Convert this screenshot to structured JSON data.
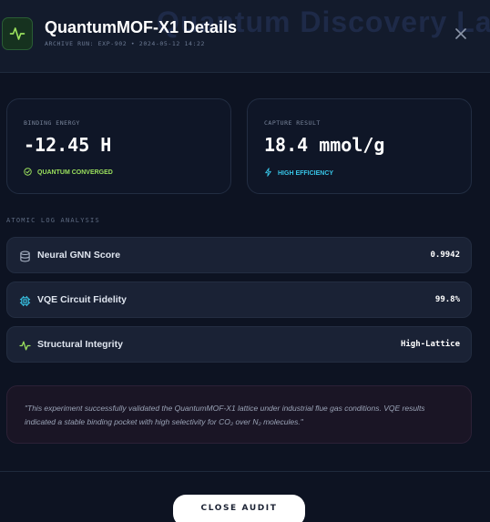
{
  "header": {
    "background_title": "Quantum Discovery Lab",
    "title": "QuantumMOF-X1 Details",
    "subtitle": "ARCHIVE RUN: EXP-902 • 2024-05-12 14:22",
    "logo_icon": "activity-pulse-icon",
    "close_icon": "close-icon"
  },
  "stats": [
    {
      "label": "BINDING ENERGY",
      "value": "-12.45 H",
      "badge": "QUANTUM CONVERGED",
      "badge_icon": "check-circle-icon",
      "badge_color": "#9be15d"
    },
    {
      "label": "CAPTURE RESULT",
      "value": "18.4 mmol/g",
      "badge": "HIGH EFFICIENCY",
      "badge_icon": "lightning-icon",
      "badge_color": "#38c6e8"
    }
  ],
  "log_section": {
    "title": "ATOMIC LOG ANALYSIS",
    "rows": [
      {
        "label": "Neural GNN Score",
        "value": "0.9942",
        "icon": "database-icon",
        "icon_color": "#aab4c6"
      },
      {
        "label": "VQE Circuit Fidelity",
        "value": "99.8%",
        "icon": "cpu-chip-icon",
        "icon_color": "#38c6e8"
      },
      {
        "label": "Structural Integrity",
        "value": "High-Lattice",
        "icon": "activity-pulse-icon",
        "icon_color": "#9be15d"
      }
    ]
  },
  "summary_quote": "\"This experiment successfully validated the QuantumMOF-X1 lattice under industrial flue gas conditions. VQE results indicated a stable binding pocket with high selectivity for CO₂ over N₂ molecules.\"",
  "footer": {
    "close_label": "CLOSE AUDIT"
  },
  "colors": {
    "background": "#0d1322",
    "accent_green": "#9be15d",
    "accent_cyan": "#38c6e8"
  }
}
